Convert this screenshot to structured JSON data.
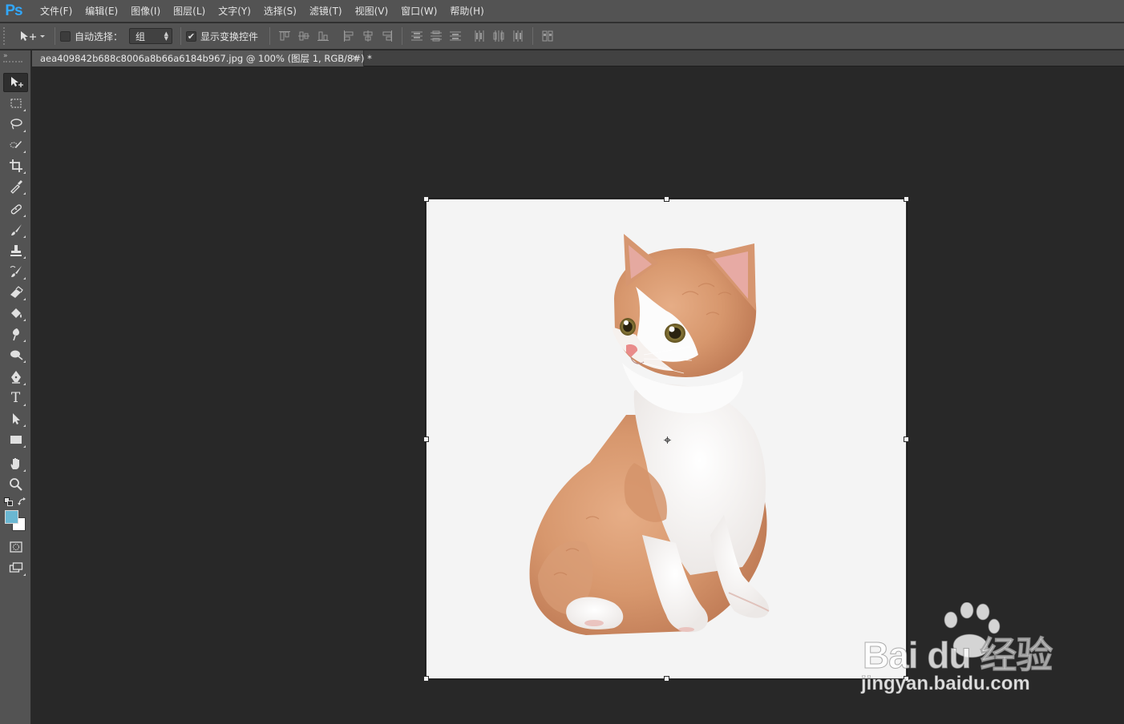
{
  "app": {
    "logo": "Ps",
    "logo_color": "#31a8ff"
  },
  "menu": [
    "文件(F)",
    "编辑(E)",
    "图像(I)",
    "图层(L)",
    "文字(Y)",
    "选择(S)",
    "滤镜(T)",
    "视图(V)",
    "窗口(W)",
    "帮助(H)"
  ],
  "options": {
    "auto_select_label": "自动选择：",
    "auto_select_checked": false,
    "auto_select_value": "组",
    "show_transform_label": "显示变换控件",
    "show_transform_checked": true,
    "show_transform_check_glyph": "✔"
  },
  "document": {
    "tab_title": "aea409842b688c8006a8b66a6184b967.jpg @ 100% (图层 1, RGB/8#) *",
    "close_glyph": "×"
  },
  "colors": {
    "foreground": "#6ab7d2",
    "background": "#ffffff",
    "canvas_bg": "#f4f4f4"
  },
  "tools": [
    "move-tool",
    "rectangular-marquee-tool",
    "lasso-tool",
    "quick-selection-tool",
    "crop-tool",
    "eyedropper-tool",
    "spot-healing-brush-tool",
    "brush-tool",
    "clone-stamp-tool",
    "history-brush-tool",
    "eraser-tool",
    "paint-bucket-tool",
    "blur-tool",
    "dodge-tool",
    "pen-tool",
    "type-tool",
    "path-selection-tool",
    "rectangle-tool",
    "hand-tool",
    "zoom-tool",
    "quick-mask-button",
    "screen-mode-button"
  ],
  "toolbar_header": {
    "collapse_glyph": "»"
  },
  "type_tool_glyph": "T",
  "watermark": {
    "logo_text": "Bai  du 经验",
    "url": "jingyan.baidu.com"
  }
}
